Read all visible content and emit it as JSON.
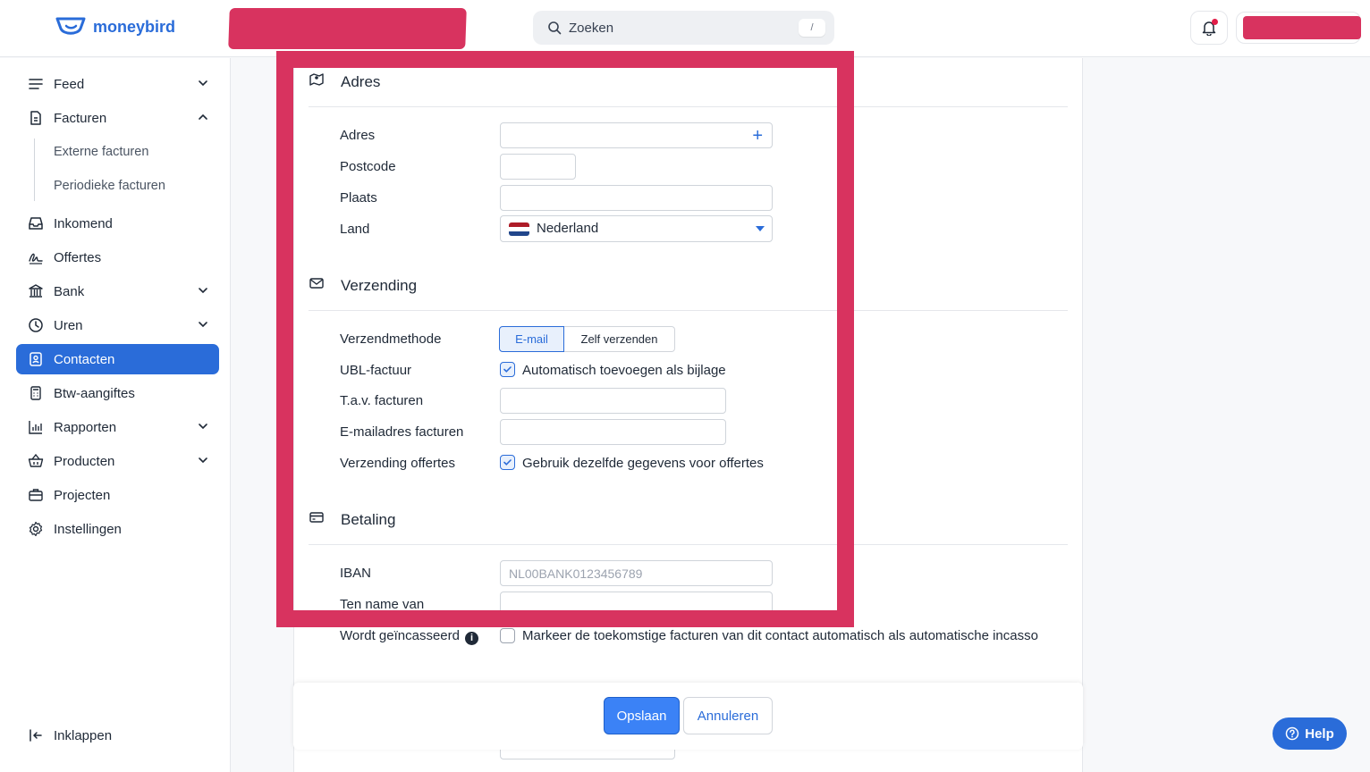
{
  "brand": {
    "name": "moneybird",
    "accent": "#2a6cd9",
    "highlight": "#d8335f"
  },
  "search": {
    "placeholder": "Zoeken",
    "shortcut": "/"
  },
  "sidebar": {
    "items": [
      {
        "label": "Feed",
        "icon": "menu-lines-icon"
      },
      {
        "label": "Facturen",
        "icon": "document-icon"
      },
      {
        "label": "Inkomend",
        "icon": "inbox-icon"
      },
      {
        "label": "Offertes",
        "icon": "signature-icon"
      },
      {
        "label": "Bank",
        "icon": "bank-icon"
      },
      {
        "label": "Uren",
        "icon": "clock-icon"
      },
      {
        "label": "Contacten",
        "icon": "contact-card-icon",
        "active": true
      },
      {
        "label": "Btw-aangiftes",
        "icon": "calculator-icon"
      },
      {
        "label": "Rapporten",
        "icon": "bar-chart-icon"
      },
      {
        "label": "Producten",
        "icon": "basket-icon"
      },
      {
        "label": "Projecten",
        "icon": "briefcase-icon"
      },
      {
        "label": "Instellingen",
        "icon": "gear-icon"
      }
    ],
    "subitems": [
      "Externe facturen",
      "Periodieke facturen"
    ],
    "collapse_label": "Inklappen"
  },
  "address": {
    "title": "Adres",
    "labels": {
      "adres": "Adres",
      "postcode": "Postcode",
      "plaats": "Plaats",
      "land": "Land"
    },
    "country": "Nederland"
  },
  "shipping": {
    "title": "Verzending",
    "labels": {
      "method": "Verzendmethode",
      "ubl": "UBL-factuur",
      "attention": "T.a.v. facturen",
      "email": "E-mailadres facturen",
      "quotes": "Verzending offertes"
    },
    "methods": [
      "E-mail",
      "Zelf verzenden"
    ],
    "ubl_checkbox": "Automatisch toevoegen als bijlage",
    "quotes_checkbox": "Gebruik dezelfde gegevens voor offertes"
  },
  "payment": {
    "title": "Betaling",
    "labels": {
      "iban": "IBAN",
      "name": "Ten name van",
      "direct_debit": "Wordt geïncasseerd"
    },
    "iban_placeholder": "NL00BANK0123456789",
    "direct_debit_checkbox": "Markeer de toekomstige facturen van dit contact automatisch als automatische incasso"
  },
  "footer": {
    "save": "Opslaan",
    "cancel": "Annuleren"
  },
  "help": {
    "label": "Help"
  }
}
